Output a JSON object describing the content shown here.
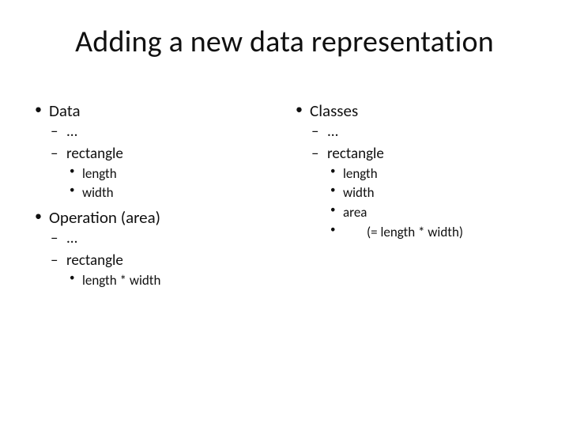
{
  "title": "Adding a new data representation",
  "left": {
    "items": [
      {
        "label": "Data",
        "sub": [
          {
            "label": "..."
          },
          {
            "label": "rectangle",
            "sub": [
              {
                "label": "length"
              },
              {
                "label": "width"
              }
            ]
          }
        ]
      },
      {
        "label": "Operation (area)",
        "sub": [
          {
            "label": "..."
          },
          {
            "label": "rectangle",
            "sub": [
              {
                "label": "length * width"
              }
            ]
          }
        ]
      }
    ]
  },
  "right": {
    "items": [
      {
        "label": "Classes",
        "sub": [
          {
            "label": "..."
          },
          {
            "label": "rectangle",
            "sub": [
              {
                "label": "length"
              },
              {
                "label": "width"
              },
              {
                "label": "area"
              },
              {
                "label": "(=  length * width)",
                "extraIndent": true
              }
            ]
          }
        ]
      }
    ]
  }
}
